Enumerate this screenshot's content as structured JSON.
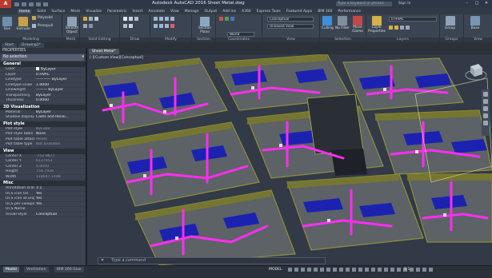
{
  "app": {
    "logo": "A",
    "title": "Autodesk AutoCAD 2016   Sheet Metal.dwg",
    "search_placeholder": "Type a keyword or phrase",
    "sign_in": "Sign In",
    "minimize": "–",
    "restore": "□",
    "close": "✕"
  },
  "ribbon_tabs": [
    "Home",
    "Solid",
    "Surface",
    "Mesh",
    "Visualize",
    "Parametric",
    "Insert",
    "Annotate",
    "View",
    "Manage",
    "Output",
    "Add-ins",
    "A360",
    "Express Tools",
    "Featured Apps",
    "BIM 360",
    "Performance"
  ],
  "ribbon": {
    "modeling": {
      "label": "Modeling",
      "box": "Box",
      "extrude": "Extrude",
      "polysolid": "Polysolid",
      "presspull": "Presspull",
      "smooth_object": "Smooth Object"
    },
    "mesh": {
      "label": "Mesh"
    },
    "solid_editing": {
      "label": "Solid Editing"
    },
    "draw": {
      "label": "Draw"
    },
    "modify": {
      "label": "Modify"
    },
    "section": {
      "label": "Section",
      "section_plane": "Section Plane"
    },
    "coordinates": {
      "label": "Coordinates",
      "world": "World"
    },
    "view": {
      "label": "View",
      "visual_style": "Conceptual",
      "view_preset": "Unsaved View"
    },
    "selection": {
      "label": "Selection",
      "culling": "Culling",
      "no_filter": "No Filter",
      "move_gizmo": "Move Gizmo"
    },
    "layers": {
      "label": "Layers",
      "layer_properties": "Layer Properties",
      "current_layer": "0 HVAC"
    },
    "groups": {
      "label": "Groups",
      "group": "Group"
    },
    "view2": {
      "label": "View",
      "base": "Base"
    }
  },
  "file_tabs": [
    "Start",
    "Drawing1*",
    "Sheet Metal*"
  ],
  "properties": {
    "title": "PROPERTIES",
    "selection": "No selection",
    "sections": [
      {
        "name": "General",
        "rows": [
          {
            "k": "Color",
            "v": "ByLayer",
            "swatch": "#ffffff"
          },
          {
            "k": "Layer",
            "v": "0 HVAC"
          },
          {
            "k": "Linetype",
            "v": "———— ByLayer"
          },
          {
            "k": "Linetype scale",
            "v": "1.0000"
          },
          {
            "k": "Lineweight",
            "v": "——— ByLayer"
          },
          {
            "k": "Transparency",
            "v": "ByLayer"
          },
          {
            "k": "Thickness",
            "v": "0.0000"
          }
        ]
      },
      {
        "name": "3D Visualization",
        "rows": [
          {
            "k": "Material",
            "v": "ByLayer"
          },
          {
            "k": "Shadow display",
            "v": "Casts and Recei..."
          }
        ]
      },
      {
        "name": "Plot style",
        "rows": [
          {
            "k": "Plot style",
            "v": "ByColor",
            "dim": true
          },
          {
            "k": "Plot style table",
            "v": "None"
          },
          {
            "k": "Plot table attach...",
            "v": "Model",
            "dim": true
          },
          {
            "k": "Plot table type",
            "v": "Not available",
            "dim": true
          }
        ]
      },
      {
        "name": "View",
        "rows": [
          {
            "k": "Center X",
            "v": "-752.8677",
            "dim": true
          },
          {
            "k": "Center Y",
            "v": "6137953",
            "dim": true
          },
          {
            "k": "Center Z",
            "v": "0.0000",
            "dim": true
          },
          {
            "k": "Height",
            "v": "754.7928",
            "dim": true
          },
          {
            "k": "Width",
            "v": "118047.1448",
            "dim": true
          }
        ]
      },
      {
        "name": "Misc",
        "rows": [
          {
            "k": "Annotation scale",
            "v": "1:1"
          },
          {
            "k": "UCS icon On",
            "v": "Yes"
          },
          {
            "k": "UCS icon at origin",
            "v": "Yes"
          },
          {
            "k": "UCS per viewport",
            "v": "Yes"
          },
          {
            "k": "UCS Name",
            "v": ""
          },
          {
            "k": "Visual Style",
            "v": "Conceptual"
          }
        ]
      }
    ]
  },
  "viewport": {
    "tab": "Sheet Metal*",
    "label": "[-][Custom View][Conceptual]",
    "viewcube_top": "TOP",
    "viewcube_compass": "WCS"
  },
  "command": {
    "placeholder": "Type a command",
    "close": "✕"
  },
  "status": {
    "layouts": [
      "Model",
      "Ventilation",
      "BIM 360 Glue"
    ],
    "model": "MODEL",
    "scale": "1:1"
  },
  "colors": {
    "accent": "#3d8fd8",
    "duct": "#ff2ef0",
    "wall": "#7d7d2c",
    "floor": "#5f6468",
    "window": "#1f1fb8"
  }
}
